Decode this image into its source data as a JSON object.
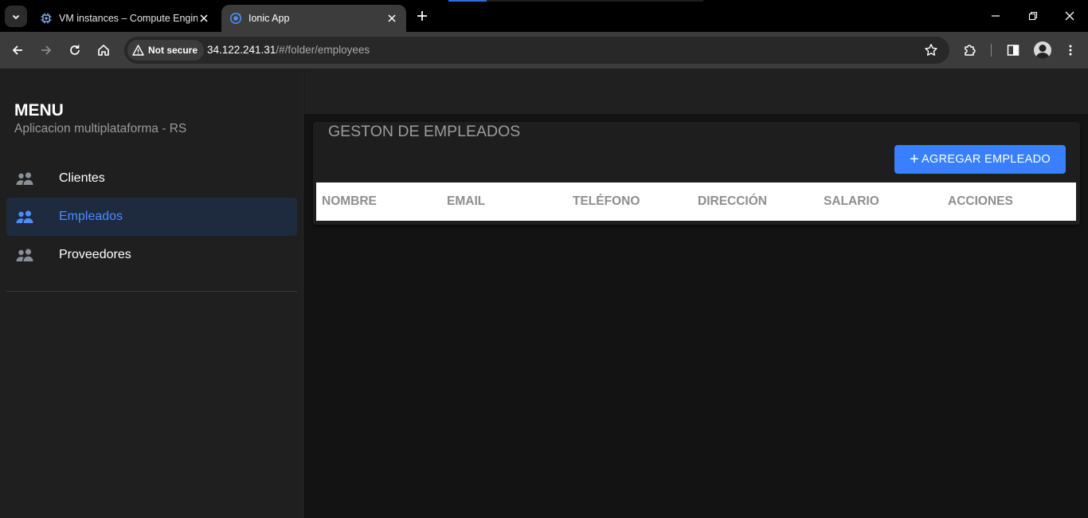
{
  "browser": {
    "tabs": [
      {
        "title": "VM instances – Compute Engine",
        "active": false,
        "icon": "chip-icon"
      },
      {
        "title": "Ionic App",
        "active": true,
        "icon": "ionic-icon"
      }
    ],
    "security_label": "Not secure",
    "url_host": "34.122.241.31",
    "url_path": "/#/folder/employees"
  },
  "sidebar": {
    "title": "MENU",
    "subtitle": "Aplicacion multiplataforma - RS",
    "items": [
      {
        "label": "Clientes",
        "icon": "people-icon",
        "selected": false
      },
      {
        "label": "Empleados",
        "icon": "people-icon",
        "selected": true
      },
      {
        "label": "Proveedores",
        "icon": "people-icon",
        "selected": false
      }
    ]
  },
  "main": {
    "title": "GESTON DE EMPLEADOS",
    "add_button_label": "AGREGAR EMPLEADO",
    "columns": [
      "NOMBRE",
      "EMAIL",
      "TELÉFONO",
      "DIRECCIÓN",
      "SALARIO",
      "ACCIONES"
    ]
  },
  "colors": {
    "accent": "#3880ff",
    "selected_text": "#4a8dff",
    "selected_bg": "#1e2a3d",
    "sidebar_bg": "#1f1f1f",
    "content_bg": "#131313"
  }
}
